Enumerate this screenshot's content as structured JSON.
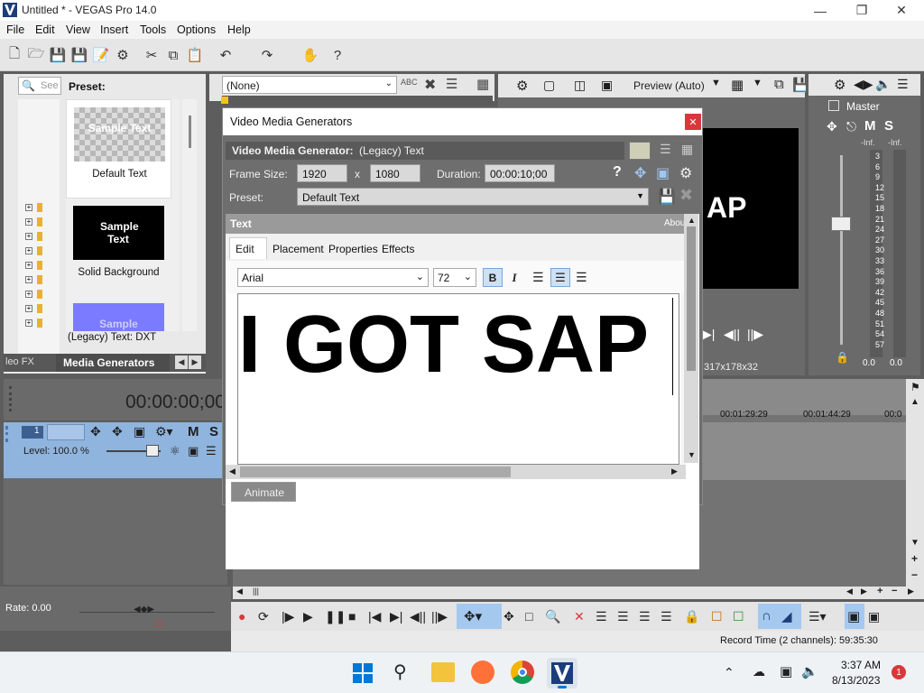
{
  "window": {
    "title": "Untitled * - VEGAS Pro 14.0",
    "minimize_icon": "minimize-icon",
    "maximize_icon": "restore-icon",
    "close_icon": "close-icon"
  },
  "menu": [
    "File",
    "Edit",
    "View",
    "Insert",
    "Tools",
    "Options",
    "Help"
  ],
  "explorer": {
    "search_placeholder": "See",
    "preset_label": "Preset:",
    "presets": [
      {
        "thumb_text": "Sample Text",
        "name": "Default Text"
      },
      {
        "thumb_text": "Sample Text",
        "name": "Solid Background"
      },
      {
        "thumb_text": "Sample",
        "name": "(Legacy) Text: DXT"
      }
    ],
    "tabs": [
      "leo FX",
      "Media Generators"
    ]
  },
  "fx_toolbar": {
    "dropdown_value": "(None)"
  },
  "preview": {
    "mode": "Preview (Auto)",
    "frame_text": "AP",
    "info": "317x178x32"
  },
  "master": {
    "label": "Master",
    "m": "M",
    "s": "S",
    "inf_left": "-Inf.",
    "inf_right": "-Inf.",
    "scale": [
      "3",
      "6",
      "9",
      "12",
      "15",
      "18",
      "21",
      "24",
      "27",
      "30",
      "33",
      "36",
      "39",
      "42",
      "45",
      "48",
      "51",
      "54",
      "57"
    ],
    "val_left": "0.0",
    "val_right": "0.0"
  },
  "dialog": {
    "title": "Video Media Generators",
    "generator_label": "Video Media Generator:",
    "generator_value": "(Legacy) Text",
    "frame_size_label": "Frame Size:",
    "width": "1920",
    "x": "x",
    "height": "1080",
    "duration_label": "Duration:",
    "duration": "00:00:10;00",
    "preset_label": "Preset:",
    "preset_value": "Default Text",
    "plugin_title": "Text",
    "about": "About",
    "tabs": [
      "Edit",
      "Placement",
      "Properties",
      "Effects"
    ],
    "font": "Arial",
    "size": "72",
    "bold": "B",
    "italic": "I",
    "text": "I GOT SAP",
    "animate": "Animate"
  },
  "timeline": {
    "timecode": "00:00:00;00",
    "track_number": "1",
    "level": "Level: 100.0 %",
    "track_m": "M",
    "track_s": "S",
    "ruler": [
      "00:01:29:29",
      "00:01:44:29",
      "00:0"
    ],
    "rate": "Rate: 0.00",
    "record_time": "Record Time (2 channels): 59:35:30"
  },
  "taskbar": {
    "time": "3:37 AM",
    "date": "8/13/2023",
    "notifications": "1"
  },
  "colors": {
    "accent_red": "#d9373c",
    "track_blue": "#8fb4dd",
    "panel_gray": "#6a6a6a"
  }
}
